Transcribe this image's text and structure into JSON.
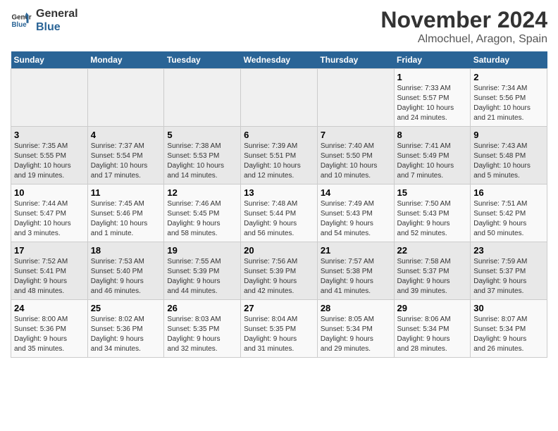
{
  "header": {
    "logo_line1": "General",
    "logo_line2": "Blue",
    "title": "November 2024",
    "subtitle": "Almochuel, Aragon, Spain"
  },
  "weekdays": [
    "Sunday",
    "Monday",
    "Tuesday",
    "Wednesday",
    "Thursday",
    "Friday",
    "Saturday"
  ],
  "weeks": [
    [
      {
        "day": "",
        "info": ""
      },
      {
        "day": "",
        "info": ""
      },
      {
        "day": "",
        "info": ""
      },
      {
        "day": "",
        "info": ""
      },
      {
        "day": "",
        "info": ""
      },
      {
        "day": "1",
        "info": "Sunrise: 7:33 AM\nSunset: 5:57 PM\nDaylight: 10 hours\nand 24 minutes."
      },
      {
        "day": "2",
        "info": "Sunrise: 7:34 AM\nSunset: 5:56 PM\nDaylight: 10 hours\nand 21 minutes."
      }
    ],
    [
      {
        "day": "3",
        "info": "Sunrise: 7:35 AM\nSunset: 5:55 PM\nDaylight: 10 hours\nand 19 minutes."
      },
      {
        "day": "4",
        "info": "Sunrise: 7:37 AM\nSunset: 5:54 PM\nDaylight: 10 hours\nand 17 minutes."
      },
      {
        "day": "5",
        "info": "Sunrise: 7:38 AM\nSunset: 5:53 PM\nDaylight: 10 hours\nand 14 minutes."
      },
      {
        "day": "6",
        "info": "Sunrise: 7:39 AM\nSunset: 5:51 PM\nDaylight: 10 hours\nand 12 minutes."
      },
      {
        "day": "7",
        "info": "Sunrise: 7:40 AM\nSunset: 5:50 PM\nDaylight: 10 hours\nand 10 minutes."
      },
      {
        "day": "8",
        "info": "Sunrise: 7:41 AM\nSunset: 5:49 PM\nDaylight: 10 hours\nand 7 minutes."
      },
      {
        "day": "9",
        "info": "Sunrise: 7:43 AM\nSunset: 5:48 PM\nDaylight: 10 hours\nand 5 minutes."
      }
    ],
    [
      {
        "day": "10",
        "info": "Sunrise: 7:44 AM\nSunset: 5:47 PM\nDaylight: 10 hours\nand 3 minutes."
      },
      {
        "day": "11",
        "info": "Sunrise: 7:45 AM\nSunset: 5:46 PM\nDaylight: 10 hours\nand 1 minute."
      },
      {
        "day": "12",
        "info": "Sunrise: 7:46 AM\nSunset: 5:45 PM\nDaylight: 9 hours\nand 58 minutes."
      },
      {
        "day": "13",
        "info": "Sunrise: 7:48 AM\nSunset: 5:44 PM\nDaylight: 9 hours\nand 56 minutes."
      },
      {
        "day": "14",
        "info": "Sunrise: 7:49 AM\nSunset: 5:43 PM\nDaylight: 9 hours\nand 54 minutes."
      },
      {
        "day": "15",
        "info": "Sunrise: 7:50 AM\nSunset: 5:43 PM\nDaylight: 9 hours\nand 52 minutes."
      },
      {
        "day": "16",
        "info": "Sunrise: 7:51 AM\nSunset: 5:42 PM\nDaylight: 9 hours\nand 50 minutes."
      }
    ],
    [
      {
        "day": "17",
        "info": "Sunrise: 7:52 AM\nSunset: 5:41 PM\nDaylight: 9 hours\nand 48 minutes."
      },
      {
        "day": "18",
        "info": "Sunrise: 7:53 AM\nSunset: 5:40 PM\nDaylight: 9 hours\nand 46 minutes."
      },
      {
        "day": "19",
        "info": "Sunrise: 7:55 AM\nSunset: 5:39 PM\nDaylight: 9 hours\nand 44 minutes."
      },
      {
        "day": "20",
        "info": "Sunrise: 7:56 AM\nSunset: 5:39 PM\nDaylight: 9 hours\nand 42 minutes."
      },
      {
        "day": "21",
        "info": "Sunrise: 7:57 AM\nSunset: 5:38 PM\nDaylight: 9 hours\nand 41 minutes."
      },
      {
        "day": "22",
        "info": "Sunrise: 7:58 AM\nSunset: 5:37 PM\nDaylight: 9 hours\nand 39 minutes."
      },
      {
        "day": "23",
        "info": "Sunrise: 7:59 AM\nSunset: 5:37 PM\nDaylight: 9 hours\nand 37 minutes."
      }
    ],
    [
      {
        "day": "24",
        "info": "Sunrise: 8:00 AM\nSunset: 5:36 PM\nDaylight: 9 hours\nand 35 minutes."
      },
      {
        "day": "25",
        "info": "Sunrise: 8:02 AM\nSunset: 5:36 PM\nDaylight: 9 hours\nand 34 minutes."
      },
      {
        "day": "26",
        "info": "Sunrise: 8:03 AM\nSunset: 5:35 PM\nDaylight: 9 hours\nand 32 minutes."
      },
      {
        "day": "27",
        "info": "Sunrise: 8:04 AM\nSunset: 5:35 PM\nDaylight: 9 hours\nand 31 minutes."
      },
      {
        "day": "28",
        "info": "Sunrise: 8:05 AM\nSunset: 5:34 PM\nDaylight: 9 hours\nand 29 minutes."
      },
      {
        "day": "29",
        "info": "Sunrise: 8:06 AM\nSunset: 5:34 PM\nDaylight: 9 hours\nand 28 minutes."
      },
      {
        "day": "30",
        "info": "Sunrise: 8:07 AM\nSunset: 5:34 PM\nDaylight: 9 hours\nand 26 minutes."
      }
    ]
  ]
}
